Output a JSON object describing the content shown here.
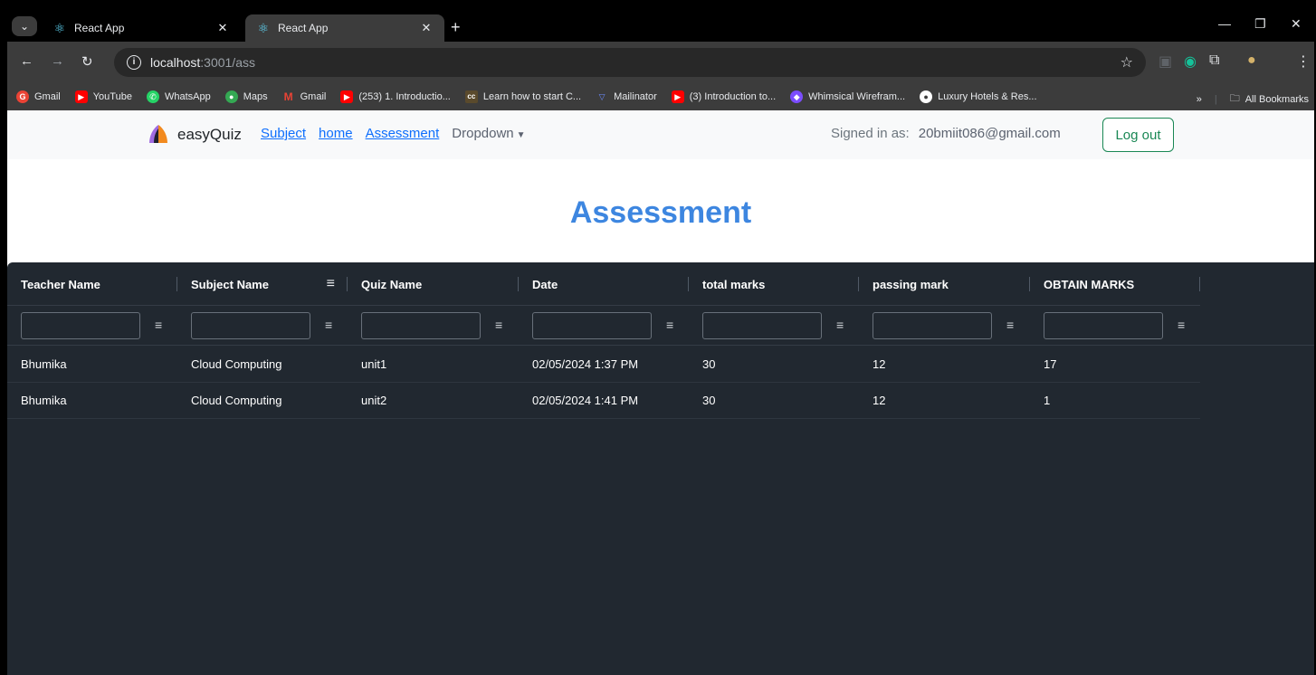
{
  "browser": {
    "tabs": [
      {
        "title": "React App"
      },
      {
        "title": "React App"
      }
    ],
    "url_host": "localhost",
    "url_path": ":3001/ass",
    "bookmarks": [
      {
        "label": "Gmail",
        "color": "#ea4335",
        "glyph": "G"
      },
      {
        "label": "YouTube",
        "color": "#ff0000",
        "glyph": "▶"
      },
      {
        "label": "WhatsApp",
        "color": "#25d366",
        "glyph": "✆"
      },
      {
        "label": "Maps",
        "color": "#34a853",
        "glyph": "●"
      },
      {
        "label": "Gmail",
        "color": "#ea4335",
        "glyph": "M"
      },
      {
        "label": "(253) 1. Introductio...",
        "color": "#ff0000",
        "glyph": "▶"
      },
      {
        "label": "Learn how to start C...",
        "color": "#5a4a2c",
        "glyph": "cc"
      },
      {
        "label": "Mailinator",
        "color": "#4a6cf7",
        "glyph": "▽"
      },
      {
        "label": "(3) Introduction to...",
        "color": "#ff0000",
        "glyph": "▶"
      },
      {
        "label": "Whimsical Wirefram...",
        "color": "#7b4dff",
        "glyph": "◆"
      },
      {
        "label": "Luxury Hotels & Res...",
        "color": "#ffffff",
        "glyph": "●"
      }
    ],
    "all_bookmarks": "All Bookmarks"
  },
  "navbar": {
    "brand": "easyQuiz",
    "links": [
      "Subject",
      "home",
      "Assessment"
    ],
    "dropdown": "Dropdown",
    "signed_label": "Signed in as:",
    "email": "20bmiit086@gmail.com",
    "logout": "Log out"
  },
  "page": {
    "heading": "Assessment"
  },
  "grid": {
    "columns": [
      "Teacher Name",
      "Subject Name",
      "Quiz Name",
      "Date",
      "total marks",
      "passing mark",
      "OBTAIN MARKS"
    ],
    "rows": [
      [
        "Bhumika",
        "Cloud Computing",
        "unit1",
        "02/05/2024 1:37 PM",
        "30",
        "12",
        "17"
      ],
      [
        "Bhumika",
        "Cloud Computing",
        "unit2",
        "02/05/2024 1:41 PM",
        "30",
        "12",
        "1"
      ]
    ]
  }
}
